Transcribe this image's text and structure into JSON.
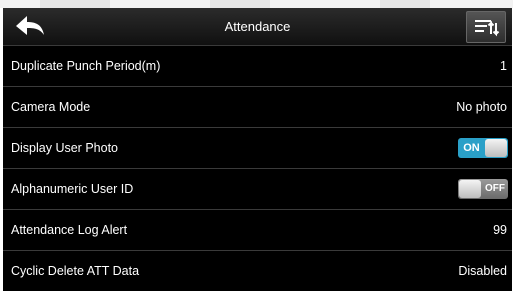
{
  "header": {
    "title": "Attendance",
    "back_icon": "back-arrow-icon",
    "menu_icon": "menu-sort-icon"
  },
  "rows": [
    {
      "label": "Duplicate Punch Period(m)",
      "value": "1"
    },
    {
      "label": "Camera Mode",
      "value": "No photo"
    },
    {
      "label": "Display User Photo",
      "toggle": "ON",
      "state": "on"
    },
    {
      "label": "Alphanumeric User ID",
      "toggle": "OFF",
      "state": "off"
    },
    {
      "label": "Attendance Log Alert",
      "value": "99"
    },
    {
      "label": "Cyclic Delete ATT Data",
      "value": "Disabled"
    }
  ],
  "colors": {
    "toggle_on": "#2aa0c8",
    "toggle_off": "#7a7a7a",
    "background": "#000000",
    "header": "#1e1e1e"
  }
}
